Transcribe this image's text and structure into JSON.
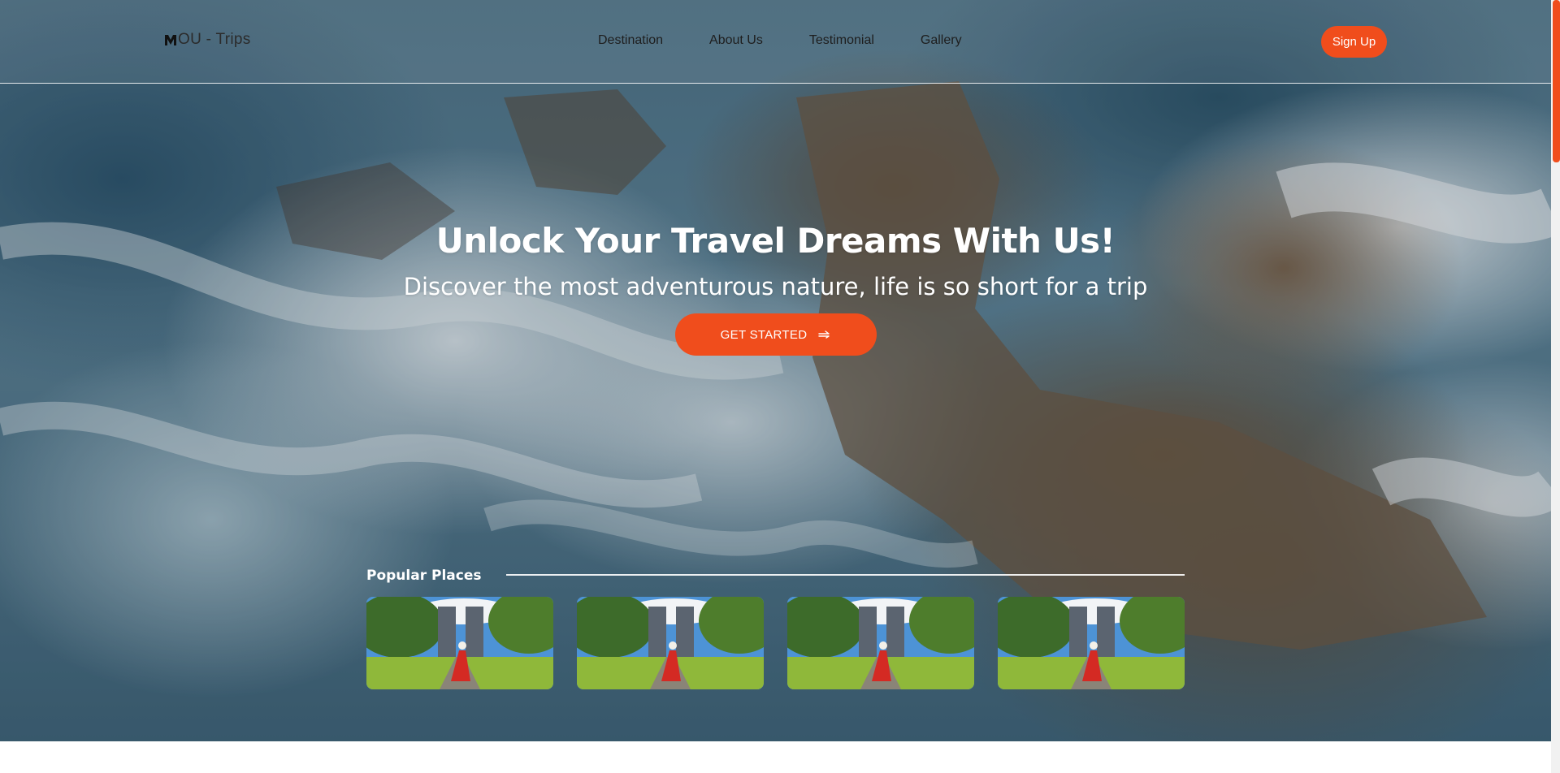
{
  "brand": {
    "name": "OU - Trips",
    "logo_icon": "mountain-m-icon"
  },
  "nav": {
    "links": [
      "Destination",
      "About Us",
      "Testimonial",
      "Gallery"
    ],
    "signup_label": "Sign Up"
  },
  "hero": {
    "title": "Unlock Your Travel Dreams With Us!",
    "subtitle": "Discover the most adventurous nature, life is so short for a trip",
    "cta_label": "GET STARTED",
    "cta_icon": "arrow-right-icon"
  },
  "popular": {
    "title": "Popular Places",
    "cards": [
      {
        "icon": "temple-gate-photo"
      },
      {
        "icon": "temple-gate-photo"
      },
      {
        "icon": "temple-gate-photo"
      },
      {
        "icon": "temple-gate-photo"
      }
    ]
  },
  "colors": {
    "accent": "#f04d1c",
    "text_dark": "#1e1e1e",
    "hero_text": "#ffffff"
  }
}
